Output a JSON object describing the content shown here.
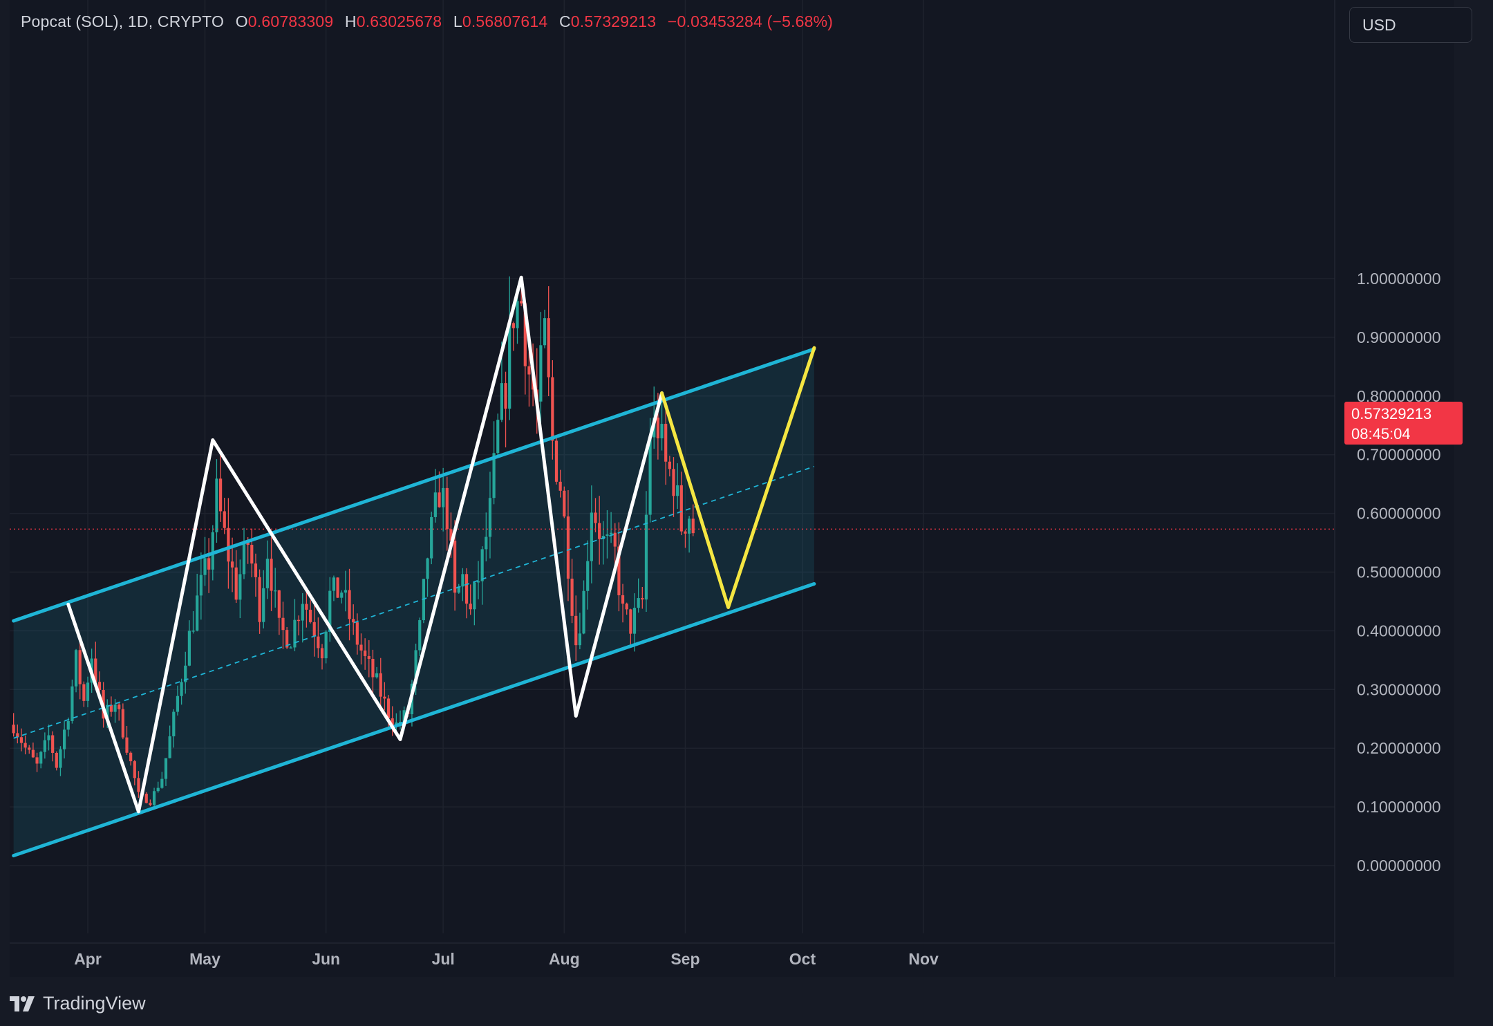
{
  "header": {
    "symbol": "Popcat (SOL), 1D, CRYPTO",
    "o_label": "O",
    "o_value": "0.60783309",
    "h_label": "H",
    "h_value": "0.63025678",
    "l_label": "L",
    "l_value": "0.56807614",
    "c_label": "C",
    "c_value": "0.57329213",
    "change": "−0.03453284 (−5.68%)"
  },
  "currency_button": "USD",
  "price_badge": {
    "price": "0.57329213",
    "countdown": "08:45:04"
  },
  "brand": "TradingView",
  "colors": {
    "background": "#131722",
    "up": "#26a69a",
    "down": "#ef5350",
    "channel": "#1fb5d6",
    "zigzag": "#ffffff",
    "projection": "#f5e642",
    "current_price": "#f23645"
  },
  "chart_data": {
    "type": "candlestick",
    "y_ticks": [
      "1.00000000",
      "0.90000000",
      "0.80000000",
      "0.70000000",
      "0.60000000",
      "0.50000000",
      "0.40000000",
      "0.30000000",
      "0.20000000",
      "0.10000000",
      "0.00000000"
    ],
    "y_tick_values": [
      1.0,
      0.9,
      0.8,
      0.7,
      0.6,
      0.5,
      0.4,
      0.3,
      0.2,
      0.1,
      0.0
    ],
    "ylim": [
      -0.08,
      1.06
    ],
    "x_ticks": [
      "Apr",
      "May",
      "Jun",
      "Jul",
      "Aug",
      "Sep",
      "Oct",
      "Nov"
    ],
    "x_tick_dates": [
      "2024-04-01",
      "2024-05-01",
      "2024-06-01",
      "2024-07-01",
      "2024-08-01",
      "2024-09-01",
      "2024-10-01",
      "2024-11-01"
    ],
    "xlim": [
      "2024-03-12",
      "2024-11-01"
    ],
    "grid": true,
    "current_price": 0.57329213,
    "candle_anchors": [
      [
        "2024-03-13",
        0.24
      ],
      [
        "2024-03-16",
        0.2
      ],
      [
        "2024-03-19",
        0.17
      ],
      [
        "2024-03-22",
        0.22
      ],
      [
        "2024-03-24",
        0.17
      ],
      [
        "2024-03-27",
        0.26
      ],
      [
        "2024-03-29",
        0.35
      ],
      [
        "2024-03-31",
        0.28
      ],
      [
        "2024-04-02",
        0.36
      ],
      [
        "2024-04-05",
        0.25
      ],
      [
        "2024-04-08",
        0.28
      ],
      [
        "2024-04-10",
        0.23
      ],
      [
        "2024-04-14",
        0.12
      ],
      [
        "2024-04-17",
        0.11
      ],
      [
        "2024-04-20",
        0.15
      ],
      [
        "2024-04-23",
        0.25
      ],
      [
        "2024-04-26",
        0.36
      ],
      [
        "2024-04-29",
        0.45
      ],
      [
        "2024-05-02",
        0.52
      ],
      [
        "2024-05-04",
        0.63
      ],
      [
        "2024-05-06",
        0.56
      ],
      [
        "2024-05-09",
        0.47
      ],
      [
        "2024-05-12",
        0.55
      ],
      [
        "2024-05-15",
        0.44
      ],
      [
        "2024-05-17",
        0.54
      ],
      [
        "2024-05-20",
        0.4
      ],
      [
        "2024-05-23",
        0.39
      ],
      [
        "2024-05-26",
        0.46
      ],
      [
        "2024-05-28",
        0.42
      ],
      [
        "2024-05-31",
        0.37
      ],
      [
        "2024-06-02",
        0.46
      ],
      [
        "2024-06-05",
        0.47
      ],
      [
        "2024-06-08",
        0.4
      ],
      [
        "2024-06-11",
        0.35
      ],
      [
        "2024-06-14",
        0.31
      ],
      [
        "2024-06-17",
        0.26
      ],
      [
        "2024-06-19",
        0.24
      ],
      [
        "2024-06-22",
        0.26
      ],
      [
        "2024-06-25",
        0.4
      ],
      [
        "2024-06-27",
        0.53
      ],
      [
        "2024-06-30",
        0.64
      ],
      [
        "2024-07-02",
        0.6
      ],
      [
        "2024-07-04",
        0.45
      ],
      [
        "2024-07-06",
        0.49
      ],
      [
        "2024-07-08",
        0.43
      ],
      [
        "2024-07-11",
        0.52
      ],
      [
        "2024-07-13",
        0.6
      ],
      [
        "2024-07-15",
        0.74
      ],
      [
        "2024-07-17",
        0.82
      ],
      [
        "2024-07-19",
        0.95
      ],
      [
        "2024-07-21",
        0.96
      ],
      [
        "2024-07-23",
        0.84
      ],
      [
        "2024-07-25",
        0.78
      ],
      [
        "2024-07-27",
        0.9
      ],
      [
        "2024-07-29",
        0.72
      ],
      [
        "2024-07-31",
        0.65
      ],
      [
        "2024-08-02",
        0.52
      ],
      [
        "2024-08-04",
        0.38
      ],
      [
        "2024-08-06",
        0.46
      ],
      [
        "2024-08-08",
        0.62
      ],
      [
        "2024-08-11",
        0.55
      ],
      [
        "2024-08-14",
        0.53
      ],
      [
        "2024-08-16",
        0.43
      ],
      [
        "2024-08-18",
        0.41
      ],
      [
        "2024-08-21",
        0.45
      ],
      [
        "2024-08-23",
        0.74
      ],
      [
        "2024-08-25",
        0.75
      ],
      [
        "2024-08-27",
        0.68
      ],
      [
        "2024-08-29",
        0.66
      ],
      [
        "2024-08-31",
        0.58
      ],
      [
        "2024-09-02",
        0.6
      ],
      [
        "2024-09-03",
        0.573
      ]
    ],
    "channel": {
      "upper": [
        [
          "2024-03-13",
          0.417
        ],
        [
          "2024-10-04",
          0.88
        ]
      ],
      "lower": [
        [
          "2024-03-13",
          0.017
        ],
        [
          "2024-10-04",
          0.48
        ]
      ],
      "midline": [
        [
          "2024-03-13",
          0.217
        ],
        [
          "2024-10-04",
          0.68
        ]
      ]
    },
    "zigzag": [
      [
        "2024-03-27",
        0.445
      ],
      [
        "2024-04-14",
        0.092
      ],
      [
        "2024-05-03",
        0.725
      ],
      [
        "2024-06-20",
        0.215
      ],
      [
        "2024-07-21",
        1.002
      ],
      [
        "2024-08-04",
        0.255
      ],
      [
        "2024-08-26",
        0.805
      ]
    ],
    "projection": [
      [
        "2024-08-26",
        0.805
      ],
      [
        "2024-09-12",
        0.44
      ],
      [
        "2024-10-04",
        0.882
      ]
    ]
  }
}
